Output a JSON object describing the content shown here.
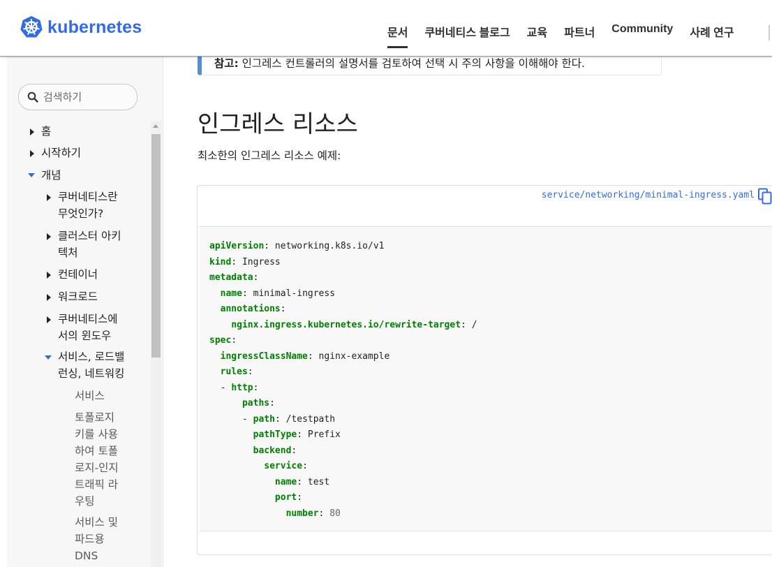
{
  "header": {
    "logo_text": "kubernetes",
    "logo_icon": "kubernetes-helm-wheel-icon",
    "brand_color": "#326ce5",
    "nav": [
      "문서",
      "쿠버네티스 블로그",
      "교육",
      "파트너",
      "Community",
      "사례 연구"
    ],
    "active_nav": "문서"
  },
  "sidebar": {
    "search_placeholder": "검색하기",
    "items": [
      {
        "label": "홈",
        "caret": "right"
      },
      {
        "label": "시작하기",
        "caret": "right"
      },
      {
        "label": "개념",
        "caret": "down"
      },
      {
        "line1": "쿠버네티스란",
        "line2": "무엇인가?",
        "caret": "right"
      },
      {
        "line1": "클러스터 아키",
        "line2": "텍처",
        "caret": "right"
      },
      {
        "label": "컨테이너",
        "caret": "right"
      },
      {
        "label": "워크로드",
        "caret": "right"
      },
      {
        "line1": "쿠버네티스에",
        "line2": "서의 윈도우",
        "caret": "right"
      },
      {
        "line1": "서비스, 로드밸",
        "line2": "런싱, 네트워킹",
        "caret": "down"
      },
      {
        "label": "서비스"
      },
      {
        "lines": [
          "토폴로지",
          "키를 사용",
          "하여 토폴",
          "로지-인지",
          "트래픽 라",
          "우팅"
        ]
      },
      {
        "lines": [
          "서비스 및",
          "파드용",
          "DNS"
        ]
      }
    ]
  },
  "main": {
    "note_label": "참고:",
    "note_text": "인그레스 컨트롤러의 설명서를 검토하여 선택 시 주의 사항을 이해해야 한다.",
    "heading": "인그레스 리소스",
    "intro": "최소한의 인그레스 리소스 예제:",
    "code_file": "service/networking/minimal-ingress.yaml",
    "copy_icon": "copy-icon",
    "code": {
      "l1k": "apiVersion",
      "l1v": " networking.k8s.io/v1",
      "l2k": "kind",
      "l2v": " Ingress",
      "l3k": "metadata",
      "l4k": "name",
      "l4v": " minimal-ingress",
      "l5k": "annotations",
      "l6k": "nginx.ingress.kubernetes.io/rewrite-target",
      "l6v": " /",
      "l7k": "spec",
      "l8k": "ingressClassName",
      "l8v": " nginx-example",
      "l9k": "rules",
      "l10k": "http",
      "l11k": "paths",
      "l12k": "path",
      "l12v": " /testpath",
      "l13k": "pathType",
      "l13v": " Prefix",
      "l14k": "backend",
      "l15k": "service",
      "l16k": "name",
      "l16v": " test",
      "l17k": "port",
      "l18k": "number",
      "l18v": "80"
    }
  }
}
